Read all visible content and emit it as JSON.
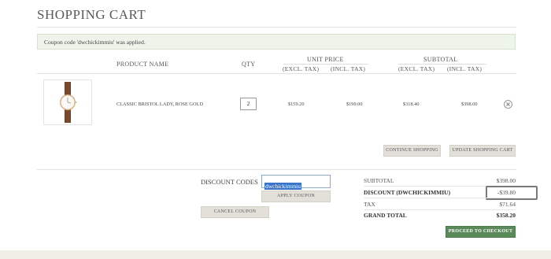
{
  "page": {
    "title": "SHOPPING CART"
  },
  "message": {
    "text": "Coupon code 'dwchickimmiu' was applied."
  },
  "table": {
    "headers": {
      "product_name": "PRODUCT NAME",
      "qty": "QTY",
      "unit_price": "UNIT PRICE",
      "subtotal": "SUBTOTAL",
      "excl_tax": "(EXCL. TAX)",
      "incl_tax": "(INCL. TAX)"
    },
    "rows": [
      {
        "product_name": "CLASSIC BRISTOL LADY, ROSE GOLD",
        "qty": "2",
        "unit_excl": "$159.20",
        "unit_incl": "$199.00",
        "sub_excl": "$318.40",
        "sub_incl": "$398.00",
        "image_icon": "watch-product-image"
      }
    ]
  },
  "actions": {
    "continue_shopping": "CONTINUE SHOPPING",
    "update_cart": "UPDATE SHOPPING CART"
  },
  "discount": {
    "label": "DISCOUNT CODES",
    "value": "dwchickimmiu",
    "apply_label": "APPLY COUPON",
    "cancel_label": "CANCEL COUPON"
  },
  "totals": {
    "subtotal_label": "SUBTOTAL",
    "subtotal_value": "$398.00",
    "discount_label": "DISCOUNT (DWCHICKIMMIU)",
    "discount_value": "-$39.80",
    "tax_label": "TAX",
    "tax_value": "$71.64",
    "grand_total_label": "GRAND TOTAL",
    "grand_total_value": "$358.20",
    "checkout_label": "PROCEED TO CHECKOUT"
  },
  "colors": {
    "accent_green": "#5b8a5a",
    "message_bg": "#eef4ea",
    "footer_bg": "#f0ede6"
  }
}
